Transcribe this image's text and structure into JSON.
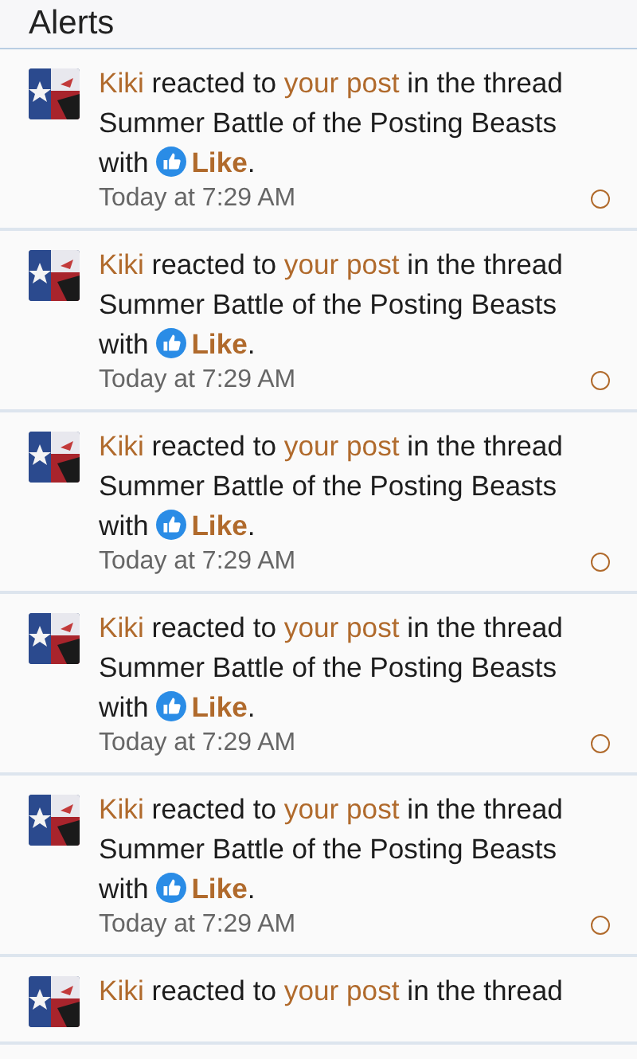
{
  "header": {
    "title": "Alerts"
  },
  "alerts": [
    {
      "user": "Kiki",
      "verb": "reacted to",
      "link": "your post",
      "middle": "in the thread Summer Battle of the Posting Beasts with",
      "reaction": "Like",
      "end": ".",
      "time": "Today at 7:29 AM"
    },
    {
      "user": "Kiki",
      "verb": "reacted to",
      "link": "your post",
      "middle": "in the thread Summer Battle of the Posting Beasts with",
      "reaction": "Like",
      "end": ".",
      "time": "Today at 7:29 AM"
    },
    {
      "user": "Kiki",
      "verb": "reacted to",
      "link": "your post",
      "middle": "in the thread Summer Battle of the Posting Beasts with",
      "reaction": "Like",
      "end": ".",
      "time": "Today at 7:29 AM"
    },
    {
      "user": "Kiki",
      "verb": "reacted to",
      "link": "your post",
      "middle": "in the thread Summer Battle of the Posting Beasts with",
      "reaction": "Like",
      "end": ".",
      "time": "Today at 7:29 AM"
    },
    {
      "user": "Kiki",
      "verb": "reacted to",
      "link": "your post",
      "middle": "in the thread Summer Battle of the Posting Beasts with",
      "reaction": "Like",
      "end": ".",
      "time": "Today at 7:29 AM"
    },
    {
      "user": "Kiki",
      "verb": "reacted to",
      "link": "your post",
      "middle": "in the thread"
    }
  ]
}
